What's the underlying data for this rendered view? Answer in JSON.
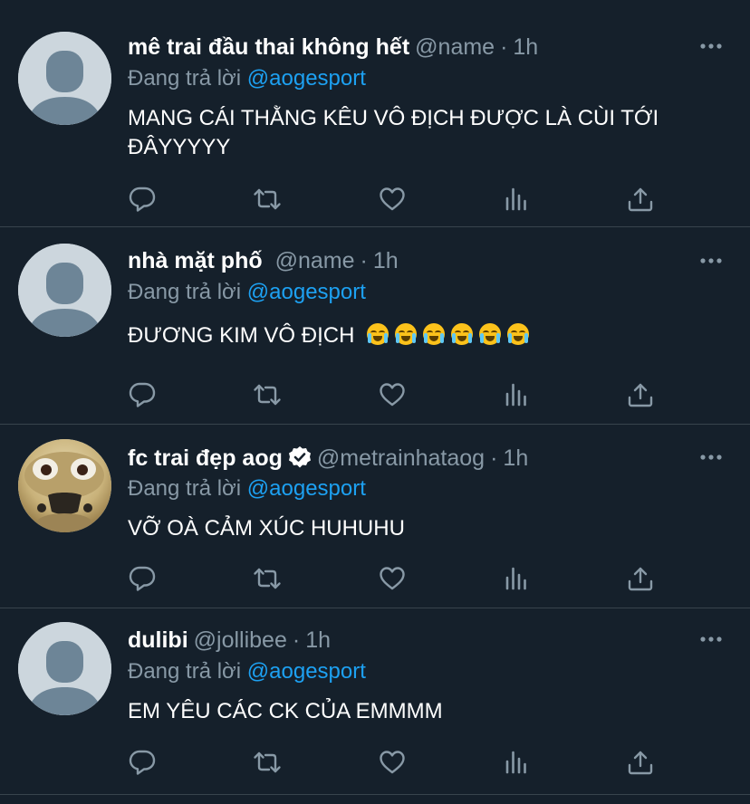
{
  "tweets": [
    {
      "name": "mê trai đầu thai không hết",
      "handle": "@name",
      "time": "1h",
      "reply_prefix": "Đang trả lời",
      "reply_to": "@aogesport",
      "text": "MANG CÁI THẰNG KÊU VÔ ĐỊCH ĐƯỢC LÀ CÙI TỚI ĐÂYYYYY",
      "avatar": "default-avatar",
      "verified": false
    },
    {
      "name": "nhà mặt phố",
      "handle": "@name",
      "time": "1h",
      "reply_prefix": "Đang trả lời",
      "reply_to": "@aogesport",
      "text": "ĐƯƠNG KIM VÔ ĐỊCH",
      "emoji": "loudly-crying-face",
      "emoji_count": 6,
      "avatar": "default-avatar",
      "verified": false
    },
    {
      "name": "fc trai đẹp aog",
      "handle": "@metrainhataog",
      "time": "1h",
      "reply_prefix": "Đang trả lời",
      "reply_to": "@aogesport",
      "text": "VỠ OÀ CẢM XÚC HUHUHU",
      "avatar": "photo-avatar",
      "verified": true
    },
    {
      "name": "dulibi",
      "handle": "@jollibee",
      "time": "1h",
      "reply_prefix": "Đang trả lời",
      "reply_to": "@aogesport",
      "text": "EM YÊU CÁC CK CỦA EMMMM",
      "avatar": "default-avatar",
      "verified": false
    }
  ],
  "separator": "·",
  "icons": [
    "reply-icon",
    "retweet-icon",
    "like-icon",
    "analytics-icon",
    "share-icon",
    "more-icon",
    "verified-badge-icon"
  ],
  "colors": {
    "background": "#15202b",
    "divider": "#38444d",
    "secondary_text": "#8899a6",
    "mention": "#1da1f2"
  }
}
